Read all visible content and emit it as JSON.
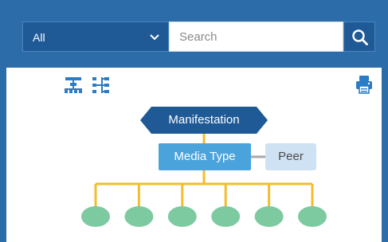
{
  "filter": {
    "selected": "All"
  },
  "search": {
    "placeholder": "Search"
  },
  "toolbar": {
    "tree_view_icon": "tree-layout-icon",
    "hierarchy_view_icon": "hierarchy-layout-icon",
    "print_icon": "print-icon"
  },
  "diagram": {
    "root": "Manifestation",
    "selected": "Media Type",
    "peer": "Peer",
    "child_count": 6
  },
  "colors": {
    "header": "#2c6ca8",
    "root_node": "#1f5a96",
    "selected_node": "#4ba3dc",
    "peer_node": "#cfe2f3",
    "connector": "#f2be2e",
    "child_node": "#7dcaa1"
  }
}
